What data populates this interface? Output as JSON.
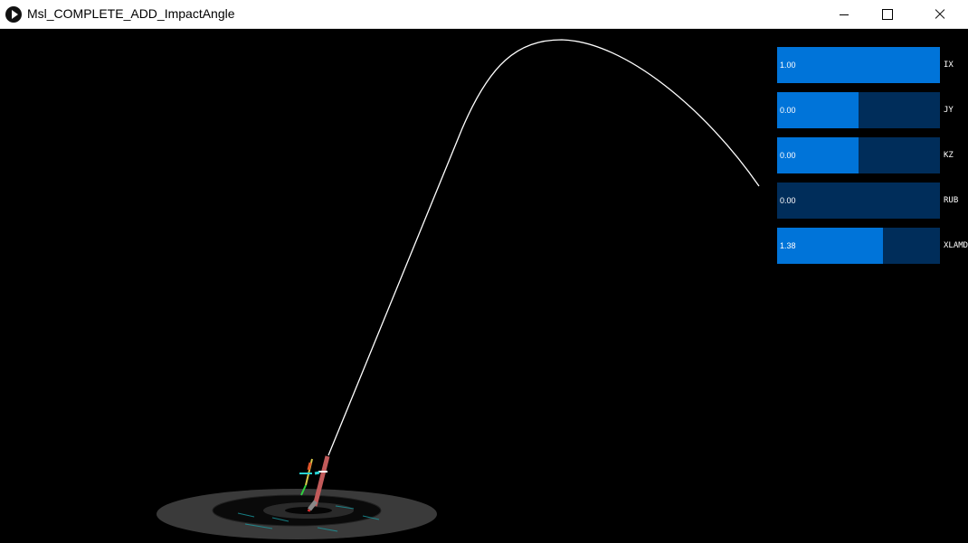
{
  "window": {
    "title": "Msl_COMPLETE_ADD_ImpactAngle"
  },
  "sliders": [
    {
      "label": "IX",
      "value_text": "1.00",
      "fill_fraction": 1.0
    },
    {
      "label": "JY",
      "value_text": "0.00",
      "fill_fraction": 0.5
    },
    {
      "label": "KZ",
      "value_text": "0.00",
      "fill_fraction": 0.5
    },
    {
      "label": "RUB",
      "value_text": "0.00",
      "fill_fraction": 0.0
    },
    {
      "label": "XLAMDA",
      "value_text": "1.38",
      "fill_fraction": 0.65
    }
  ],
  "colors": {
    "slider_fill": "#0074d9",
    "slider_bg": "#002d5a",
    "trajectory": "#ffffff"
  }
}
